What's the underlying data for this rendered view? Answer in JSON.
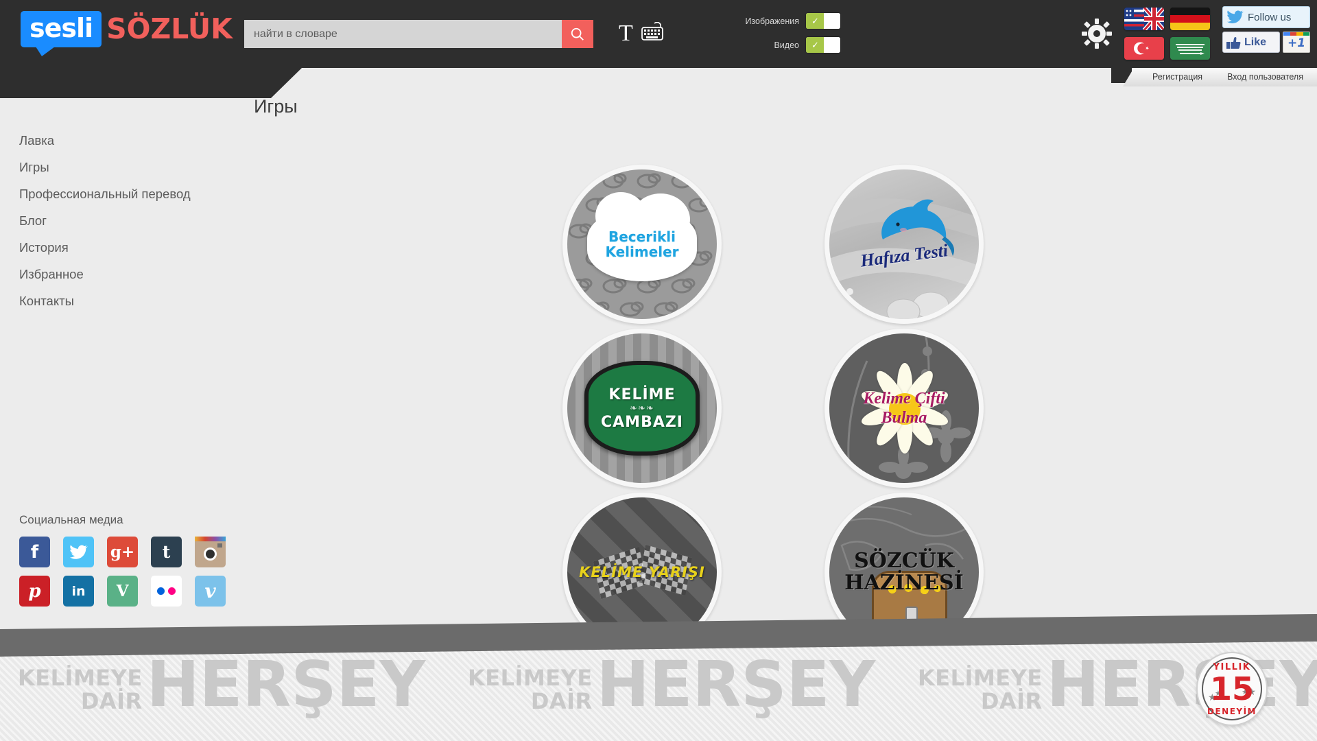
{
  "header": {
    "logo": {
      "badge": "sesli",
      "word": "SÖZLÜK"
    },
    "search": {
      "value": "",
      "placeholder": "найти в словаре"
    },
    "icons": {
      "search": "search-icon",
      "text": "T",
      "keyboard": "keyboard-icon",
      "gear": "gear-icon"
    },
    "toggles": [
      {
        "label": "Изображения",
        "state": "on",
        "check": "✓"
      },
      {
        "label": "Видео",
        "state": "on",
        "check": "✓"
      }
    ],
    "flags": [
      {
        "name": "flag-en",
        "title": "English"
      },
      {
        "name": "flag-de",
        "title": "Deutsch"
      },
      {
        "name": "flag-tr",
        "title": "Türkçe"
      },
      {
        "name": "flag-ar",
        "title": "العربية"
      }
    ],
    "social_buttons": {
      "twitter_follow": "Follow us",
      "facebook_like": "Like",
      "google_plusone": "+1"
    },
    "auth_tabs": [
      {
        "label": "Регистрация"
      },
      {
        "label": "Вход пользователя"
      }
    ]
  },
  "page": {
    "title": "Игры"
  },
  "sidebar": {
    "items": [
      {
        "label": "Лавка"
      },
      {
        "label": "Игры"
      },
      {
        "label": "Профессиональный перевод"
      },
      {
        "label": "Блог"
      },
      {
        "label": "История"
      },
      {
        "label": "Избранное"
      },
      {
        "label": "Контакты"
      }
    ],
    "social": {
      "title": "Социальная медиа",
      "items": [
        {
          "name": "facebook",
          "glyph": "f",
          "color": "#3b5998"
        },
        {
          "name": "twitter",
          "glyph": "🐦",
          "color": "#4fc3f7"
        },
        {
          "name": "google-plus",
          "glyph": "g+",
          "color": "#dd4b39"
        },
        {
          "name": "tumblr",
          "glyph": "t",
          "color": "#2c4050"
        },
        {
          "name": "instagram",
          "glyph": "◉",
          "color": "#c0a68c"
        },
        {
          "name": "pinterest",
          "glyph": "p",
          "color": "#cb2027"
        },
        {
          "name": "linkedin",
          "glyph": "in",
          "color": "#1471a4"
        },
        {
          "name": "vine",
          "glyph": "V",
          "color": "#5ab187"
        },
        {
          "name": "flickr",
          "glyph": "••",
          "color": "#ffffff"
        },
        {
          "name": "vimeo",
          "glyph": "v",
          "color": "#7cc2ea"
        }
      ]
    }
  },
  "games": [
    {
      "id": "becerikli-kelimeler",
      "title": "Becerikli Kelimeler",
      "line1": "Becerikli",
      "line2": "Kelimeler",
      "theme": "clouds"
    },
    {
      "id": "hafiza-testi",
      "title": "Hafıza Testi",
      "line1": "Hafıza Testi",
      "line2": "",
      "theme": "beach-dolphin"
    },
    {
      "id": "kelime-cambazi",
      "title": "KELİME CAMBAZI",
      "line1": "KELİME",
      "line2": "CAMBAZI",
      "theme": "green-badge"
    },
    {
      "id": "kelime-cifti-bulma",
      "title": "Kelime Çifti Bulma",
      "line1": "Kelime Çifti",
      "line2": "Bulma",
      "theme": "daisy"
    },
    {
      "id": "kelime-yarisi",
      "title": "KELİME YARIŞI",
      "line1": "KELİME YARIŞI",
      "line2": "",
      "theme": "racing"
    },
    {
      "id": "sozcuk-hazinesi",
      "title": "SÖZCÜK HAZİNESİ",
      "line1": "SÖZCÜK",
      "line2": "HAZİNESİ",
      "theme": "treasure"
    }
  ],
  "footer": {
    "watermark": {
      "small_line1": "KELİMEYE",
      "small_line2": "DAİR",
      "big": "HERŞEY"
    },
    "badge": {
      "top": "YILLIK",
      "number": "15",
      "bottom": "DENEYİM"
    }
  },
  "colors": {
    "header_bg": "#2e2e2e",
    "accent_red": "#f2605c",
    "logo_blue": "#1a8cff",
    "toggle_green": "#a7c748",
    "page_bg": "#ececec"
  }
}
